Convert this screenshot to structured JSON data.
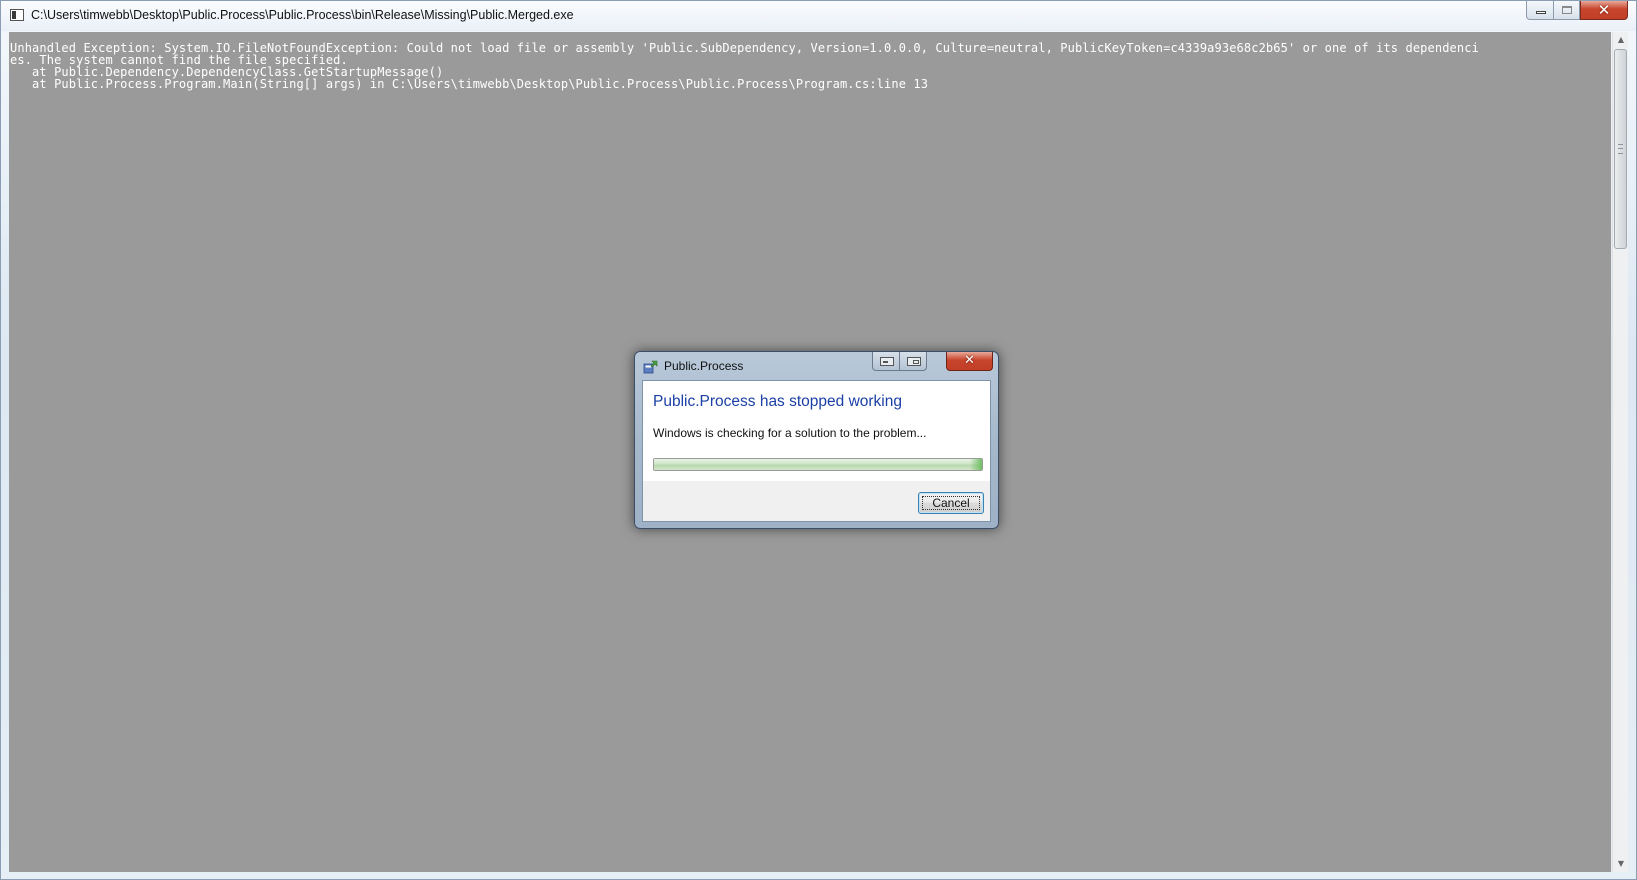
{
  "console_window": {
    "title": "C:\\Users\\timwebb\\Desktop\\Public.Process\\Public.Process\\bin\\Release\\Missing\\Public.Merged.exe",
    "output_lines": [
      "Unhandled Exception: System.IO.FileNotFoundException: Could not load file or assembly 'Public.SubDependency, Version=1.0.0.0, Culture=neutral, PublicKeyToken=c4339a93e68c2b65' or one of its dependenci",
      "es. The system cannot find the file specified.",
      "   at Public.Dependency.DependencyClass.GetStartupMessage()",
      "   at Public.Process.Program.Main(String[] args) in C:\\Users\\timwebb\\Desktop\\Public.Process\\Public.Process\\Program.cs:line 13"
    ],
    "background_color": "#9a9a9a",
    "text_color": "#ffffff",
    "icons": {
      "window": "console-window-icon",
      "minimize": "minimize-icon",
      "maximize": "maximize-icon",
      "close": "close-icon"
    }
  },
  "dialog": {
    "title": "Public.Process",
    "heading": "Public.Process has stopped working",
    "message": "Windows is checking for a solution to the problem...",
    "progress_fraction": 1.0,
    "cancel_label": "Cancel",
    "heading_color": "#1a3fa5",
    "icons": {
      "app": "windows-error-reporting-icon",
      "close": "close-icon"
    }
  }
}
